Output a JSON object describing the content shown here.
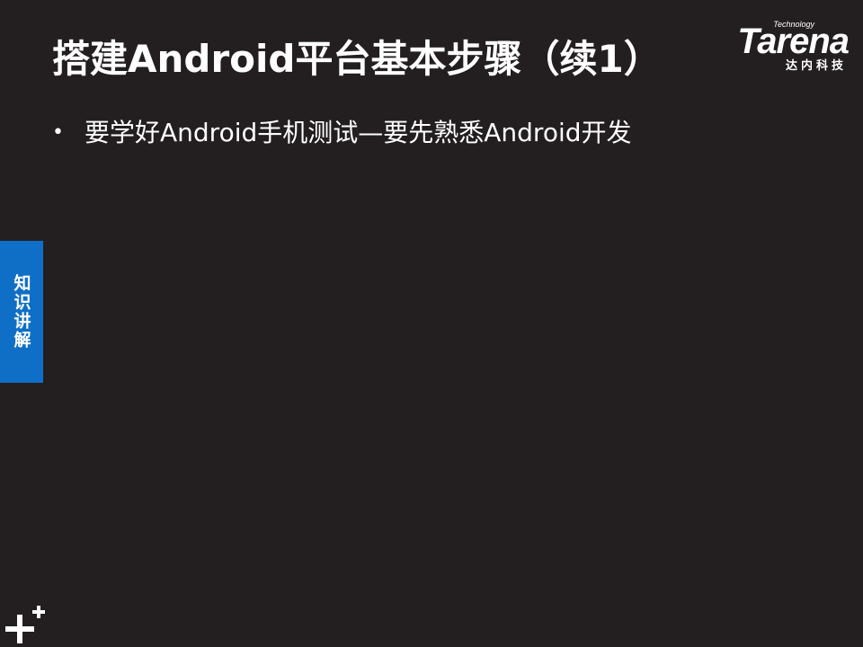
{
  "slide": {
    "title": "搭建Android平台基本步骤（续1）",
    "bullets": [
      "要学好Android手机测试—要先熟悉Android开发"
    ],
    "bullet_glyph": "•"
  },
  "logo": {
    "tagline": "Technology",
    "wordmark": "Tarena",
    "subtitle": "达内科技"
  },
  "side_tab": {
    "label": "知识讲解",
    "color": "#0f6fc6"
  },
  "theme": {
    "background": "#231f20",
    "text": "#ffffff"
  },
  "icons": {
    "corner_decoration": "plus-sign-icon"
  }
}
